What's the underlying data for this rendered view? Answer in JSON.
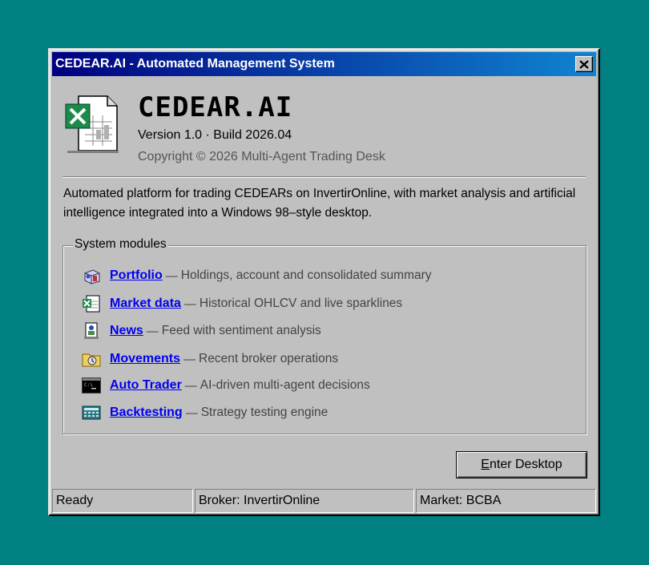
{
  "window": {
    "title": "CEDEAR.AI - Automated Management System",
    "close_label": "✕"
  },
  "header": {
    "app_name": "CEDEAR.AI",
    "version": "Version 1.0 · Build 2026.04",
    "copyright": "Copyright © 2026 Multi-Agent Trading Desk",
    "icon": "spreadsheet-app-icon"
  },
  "description": "Automated platform for trading CEDEARs on InvertirOnline, with market analysis and artificial intelligence integrated into a Windows 98–style desktop.",
  "modules": {
    "legend": "System modules",
    "separator": "—",
    "items": [
      {
        "name": "Portfolio",
        "desc": "Holdings, account and consolidated summary",
        "icon": "portfolio-icon"
      },
      {
        "name": "Market data",
        "desc": "Historical OHLCV and live sparklines",
        "icon": "spreadsheet-icon"
      },
      {
        "name": "News",
        "desc": "Feed with sentiment analysis",
        "icon": "document-icon"
      },
      {
        "name": "Movements",
        "desc": "Recent broker operations",
        "icon": "folder-icon"
      },
      {
        "name": "Auto Trader",
        "desc": "AI-driven multi-agent decisions",
        "icon": "terminal-icon"
      },
      {
        "name": "Backtesting",
        "desc": "Strategy testing engine",
        "icon": "calculator-icon"
      }
    ]
  },
  "button": {
    "accel": "E",
    "rest": "nter Desktop"
  },
  "status": {
    "ready": "Ready",
    "broker": "Broker: InvertirOnline",
    "market": "Market: BCBA"
  },
  "colors": {
    "desktop": "#008080",
    "titlebar_start": "#000080",
    "titlebar_end": "#1084d0",
    "link": "#0000ee"
  }
}
